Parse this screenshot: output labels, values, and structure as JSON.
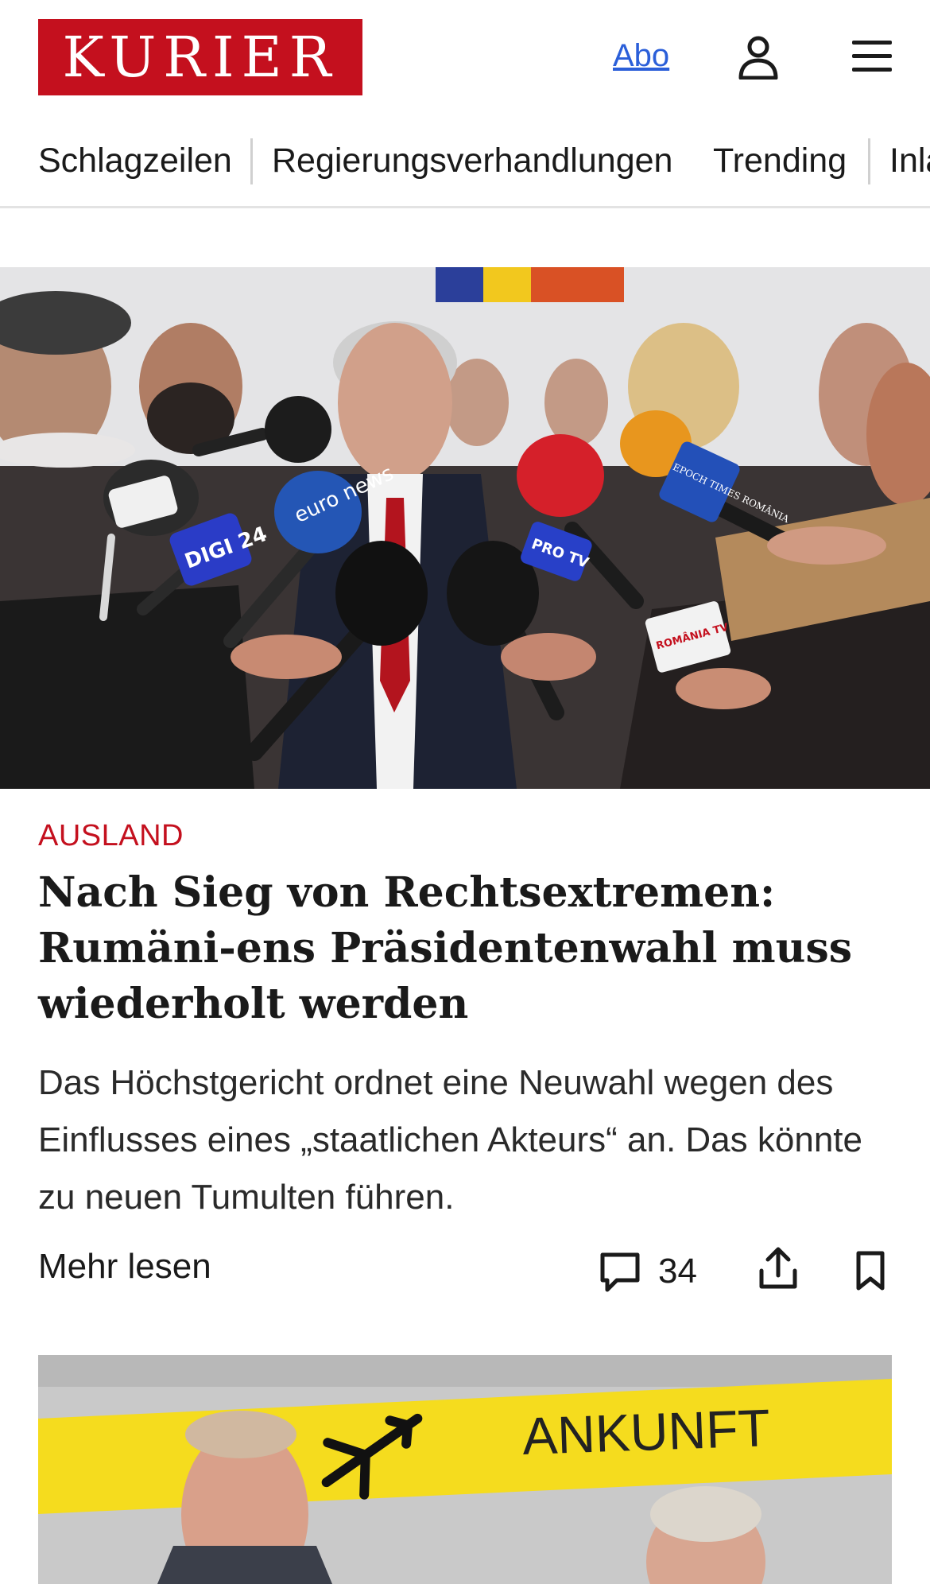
{
  "header": {
    "logo_text": "KURIER",
    "abo_label": "Abo",
    "user_icon": "user-icon",
    "menu_icon": "hamburger-menu-icon"
  },
  "nav": {
    "items": [
      {
        "label": "Schlagzeilen"
      },
      {
        "label": "Regierungsverhandlungen"
      },
      {
        "label": "Trending"
      },
      {
        "label": "Inla"
      }
    ]
  },
  "article": {
    "kicker": "AUSLAND",
    "headline": "Nach Sieg von Rechtsextremen: Rumäni-ens Präsidentenwahl muss wiederholt werden",
    "teaser": "Das Höchstgericht ordnet eine Neuwahl wegen des Einflusses eines „staatlichen Akteurs“ an. Das könnte zu neuen Tumulten führen.",
    "read_more": "Mehr lesen",
    "comment_count": "34",
    "mic_labels": [
      "euro news",
      "DIGI 24",
      "PRO TV",
      "EPOCH TIMES ROMÂNIA",
      "ROMÂNIA TV"
    ]
  },
  "article2": {
    "sign_text": "ANKUNFT"
  },
  "colors": {
    "brand_red": "#c4101e",
    "link_blue": "#2b5fd9",
    "text": "#1a1a1a"
  }
}
